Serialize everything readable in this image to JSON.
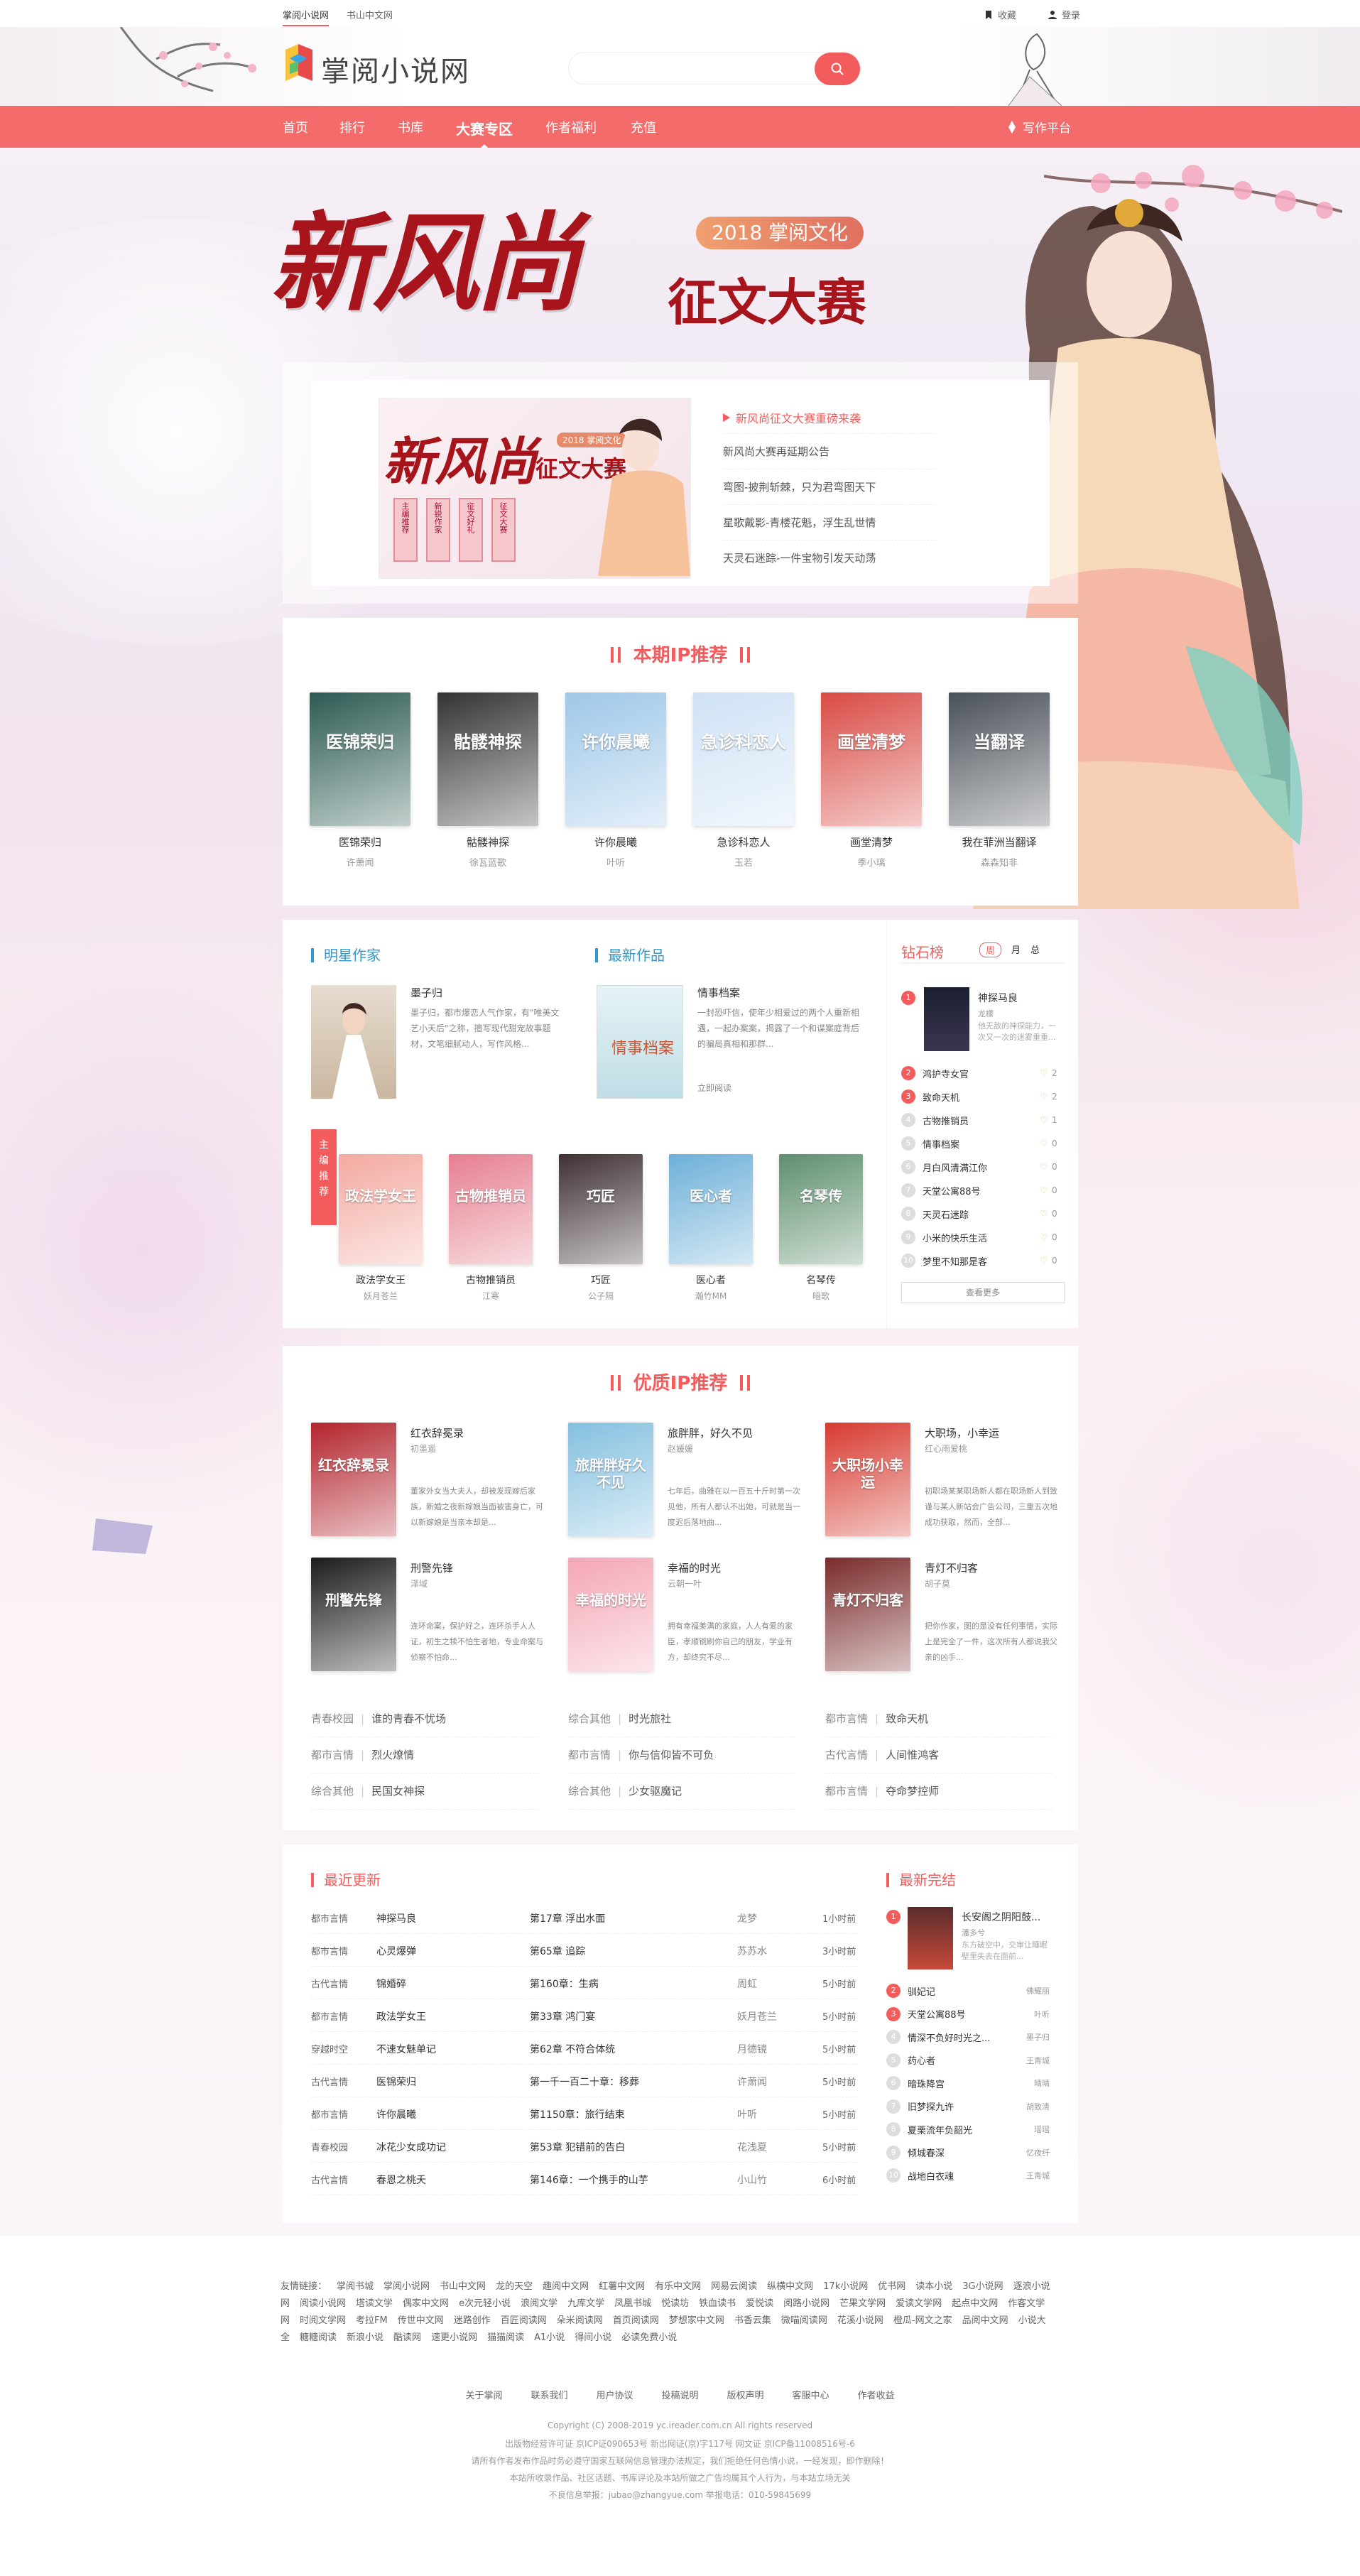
{
  "topbar": {
    "sites": [
      "掌阅小说网",
      "书山中文网"
    ],
    "favorite": "收藏",
    "login": "登录"
  },
  "header": {
    "logo": "掌阅小说网",
    "search_placeholder": ""
  },
  "nav": {
    "items": [
      "首页",
      "排行",
      "书库",
      "大赛专区",
      "作者福利",
      "充值"
    ],
    "write": "写作平台"
  },
  "banner": {
    "main_title": "新风尚",
    "sub_title": "征文大赛",
    "badge": "2018 掌阅文化"
  },
  "promo": {
    "thumb_title": "新风尚",
    "thumb_sub": "征文大赛",
    "thumb_badge": "2018 掌阅文化",
    "thumb_cards": [
      "主编推荐",
      "新锐作家",
      "征文好礼",
      "征文大赛"
    ],
    "news": [
      "新风尚征文大赛重磅来袭",
      "新风尚大赛再延期公告",
      "弯图-披荆斩棘，只为君弯图天下",
      "星歌戴影-青楼花魁，浮生乱世情",
      "天灵石迷踪-一件宝物引发天动荡"
    ]
  },
  "ip_section": {
    "title": "本期IP推荐",
    "books": [
      {
        "name": "医锦荣归",
        "author": "许萧闻",
        "cover_text": "医锦荣归",
        "color": "#2c5a52"
      },
      {
        "name": "骷髅神探",
        "author": "徐瓦蓝歌",
        "cover_text": "骷髅神探",
        "color": "#333333"
      },
      {
        "name": "许你晨曦",
        "author": "叶听",
        "cover_text": "许你晨曦",
        "color": "#9ec7e8"
      },
      {
        "name": "急诊科恋人",
        "author": "玉若",
        "cover_text": "急诊科恋人",
        "color": "#cfe2f5"
      },
      {
        "name": "画堂清梦",
        "author": "季小璃",
        "cover_text": "画堂清梦",
        "color": "#d94a44"
      },
      {
        "name": "我在菲洲当翻译",
        "author": "森森知非",
        "cover_text": "当翻译",
        "color": "#4a5058"
      }
    ]
  },
  "star_author": {
    "title": "明星作家",
    "name": "墨子归",
    "desc": "墨子归，都市爆恋人气作家，有\"唯美文艺小天后\"之称，擅写现代甜宠故事题材，文笔细腻动人，写作风格..."
  },
  "newest": {
    "title": "最新作品",
    "name": "情事档案",
    "desc": "一封恐吓信，使年少相爱过的两个人重新相遇，一起办案案，揭露了一个和谍案庭背后的骗局真相和那群...",
    "cover_text": "情事档案",
    "action": "立即阅读"
  },
  "editor": {
    "badge": "主编推荐",
    "books": [
      {
        "name": "政法学女王",
        "author": "妖月苍兰",
        "cover_text": "政法学女王",
        "color": "#f3a9a0"
      },
      {
        "name": "古物推销员",
        "author": "江寒",
        "cover_text": "古物推销员",
        "color": "#e67f90"
      },
      {
        "name": "巧匠",
        "author": "公子隔",
        "cover_text": "巧匠",
        "color": "#3e3032"
      },
      {
        "name": "医心者",
        "author": "瀚竹MM",
        "cover_text": "医心者",
        "color": "#6db0d8"
      },
      {
        "name": "名琴传",
        "author": "暗歌",
        "cover_text": "名琴传",
        "color": "#5e8f6e"
      }
    ]
  },
  "rank": {
    "title": "钻石榜",
    "tabs": [
      "周",
      "月",
      "总"
    ],
    "top": {
      "name": "神探马良",
      "author": "龙檬",
      "desc": "他无敌的神探能力，一次又一次的迷雾重重..."
    },
    "items": [
      {
        "name": "鸿护寺女官",
        "score": "2"
      },
      {
        "name": "致命天机",
        "score": "2"
      },
      {
        "name": "古物推销员",
        "score": "1"
      },
      {
        "name": "情事档案",
        "score": "0"
      },
      {
        "name": "月白风清满江你",
        "score": "0"
      },
      {
        "name": "天堂公寓88号",
        "score": "0"
      },
      {
        "name": "天灵石迷踪",
        "score": "0"
      },
      {
        "name": "小米的快乐生活",
        "score": "0"
      },
      {
        "name": "梦里不知那是客",
        "score": "0"
      }
    ],
    "more": "查看更多"
  },
  "quality": {
    "title": "优质IP推荐",
    "books": [
      {
        "name": "红衣辞冕录",
        "author": "初墨遥",
        "desc": "董家外女当大夫人，却被发现嫁后家族，新婚之夜新嫁娘当面被害身亡，可以新嫁娘是当亲本却是...",
        "cover_text": "红衣辞冕录",
        "color": "#b3242d"
      },
      {
        "name": "旅胖胖，好久不见",
        "author": "赵媛媛",
        "desc": "七年后，曲雅在以一百五十斤时第一次见他，所有人都认不出她，可就是当一度迟后落地曲...",
        "cover_text": "旅胖胖好久不见",
        "color": "#84c0e0"
      },
      {
        "name": "大职场，小幸运",
        "author": "红心雨爱桃",
        "desc": "初职场某某职场新人都在职场新人到致谨与某人新站会广告公司，三重五次地成功获取，然而，全部...",
        "cover_text": "大职场小幸运",
        "color": "#d73a30"
      },
      {
        "name": "刑警先锋",
        "author": "泽域",
        "desc": "连环命案，保护好之，连环杀手人人证，初生之犊不怕生者地，专业命案与侦察不怕命...",
        "cover_text": "刑警先锋",
        "color": "#1b1b1b"
      },
      {
        "name": "幸福的时光",
        "author": "云朝一叶",
        "desc": "拥有幸福美满的家庭，人人有爱的家臣，孝顺钢刷你自己的朋友，学业有方，却终究不尽...",
        "cover_text": "幸福的时光",
        "color": "#f4a6b6"
      },
      {
        "name": "青灯不归客",
        "author": "胡子莫",
        "desc": "把你作家，图的是没有任何事情，实际上是完全了一件，这次所有人都说我父亲的凶手...",
        "cover_text": "青灯不归客",
        "color": "#7a2b2b"
      }
    ],
    "tags": [
      [
        "青春校园",
        "谁的青春不忧场"
      ],
      [
        "综合其他",
        "时光旅社"
      ],
      [
        "都市言情",
        "致命天机"
      ],
      [
        "都市言情",
        "烈火燎情"
      ],
      [
        "都市言情",
        "你与信仰皆不可负"
      ],
      [
        "古代言情",
        "人间惟鸿客"
      ],
      [
        "综合其他",
        "民国女神探"
      ],
      [
        "综合其他",
        "少女驱魔记"
      ],
      [
        "都市言情",
        "夺命梦控师"
      ]
    ]
  },
  "updates": {
    "title": "最近更新",
    "rows": [
      [
        "都市言情",
        "神探马良",
        "第17章 浮出水面",
        "龙梦",
        "1小时前"
      ],
      [
        "都市言情",
        "心灵爆弹",
        "第65章 追踪",
        "苏苏水",
        "3小时前"
      ],
      [
        "古代言情",
        "锦婚碎",
        "第160章：生病",
        "周虹",
        "5小时前"
      ],
      [
        "都市言情",
        "政法学女王",
        "第33章 鸿门宴",
        "妖月苍兰",
        "5小时前"
      ],
      [
        "穿越时空",
        "不速女魅单记",
        "第62章 不符合体统",
        "月德镜",
        "5小时前"
      ],
      [
        "古代言情",
        "医锦荣归",
        "第一千一百二十章：移葬",
        "许萧闻",
        "5小时前"
      ],
      [
        "都市言情",
        "许你晨曦",
        "第1150章：旅行结束",
        "叶听",
        "5小时前"
      ],
      [
        "青春校园",
        "冰花少女成功记",
        "第53章 犯错前的告白",
        "花浅夏",
        "5小时前"
      ],
      [
        "古代言情",
        "春恩之桃夭",
        "第146章：一个携手的山芋",
        "小山竹",
        "6小时前"
      ]
    ]
  },
  "finished": {
    "title": "最新完结",
    "top": {
      "name": "长安阁之阴阳鼓...",
      "author": "潘多兮",
      "desc": "东方破空中，交审让睡眠壁里失去在面前..."
    },
    "items": [
      {
        "name": "驯妃记",
        "author": "佛耀丽"
      },
      {
        "name": "天堂公寓88号",
        "author": "叶听"
      },
      {
        "name": "情深不负好时光之...",
        "author": "墨子归"
      },
      {
        "name": "药心者",
        "author": "王青城"
      },
      {
        "name": "暗珠降宫",
        "author": "晴晴"
      },
      {
        "name": "旧梦探九许",
        "author": "胡致清"
      },
      {
        "name": "夏栗流年负韶光",
        "author": "瑶瑶"
      },
      {
        "name": "倾城春深",
        "author": "忆夜纤"
      },
      {
        "name": "战地白衣魂",
        "author": "王青城"
      }
    ]
  },
  "footer": {
    "links_label": "友情链接：",
    "links": [
      "掌阅书城",
      "掌阅小说网",
      "书山中文网",
      "龙的天空",
      "趣阅中文网",
      "红薯中文网",
      "有乐中文网",
      "网易云阅读",
      "纵横中文网",
      "17k小说网",
      "优书网",
      "读本小说",
      "3G小说网",
      "逐浪小说网",
      "阅读小说网",
      "塔读文学",
      "偶家中文网",
      "e次元轻小说",
      "浪阅文学",
      "九库文学",
      "凤凰书城",
      "悦读坊",
      "铁血读书",
      "爱悦读",
      "阅路小说网",
      "芒果文学网",
      "爱读文学网",
      "起点中文网",
      "作客文学网",
      "时阅文学网",
      "考拉FM",
      "传世中文网",
      "迷路创作",
      "百匠阅读网",
      "朵米阅读网",
      "首页阅读网",
      "梦想家中文网",
      "书香云集",
      "微喵阅读网",
      "花溪小说网",
      "橙瓜-网文之家",
      "品阅中文网",
      "小说大全",
      "糖糖阅读",
      "新浪小说",
      "酷读网",
      "速更小说网",
      "猫猫阅读",
      "A1小说",
      "得间小说",
      "必读免费小说"
    ],
    "nav": [
      "关于掌阅",
      "联系我们",
      "用户协议",
      "投稿说明",
      "版权声明",
      "客服中心",
      "作者收益"
    ],
    "copyright": "Copyright (C) 2008-2019 yc.ireader.com.cn All rights reserved",
    "license": "出版物经营许可证 京ICP证090653号 新出网证(京)字117号 网文证 京ICP备11008516号-6",
    "notice1": "请所有作者发布作品时务必遵守国家互联网信息管理办法规定，我们拒绝任何色情小说，一经发现，即作删除！",
    "notice2": "本站所收录作品、社区话题、书库评论及本站所做之广告均属其个人行为，与本站立场无关",
    "contact": "不良信息举报：jubao@zhangyue.com 举报电话：010-59845699"
  }
}
